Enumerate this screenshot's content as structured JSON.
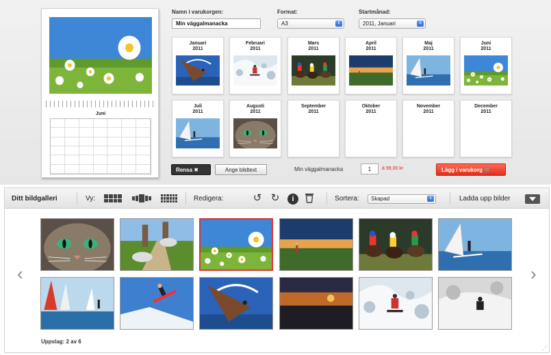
{
  "editor": {
    "name_label": "Namn i varukorgen:",
    "name_value": "Min väggalmanacka",
    "format_label": "Format:",
    "format_value": "A3",
    "start_label": "Startmånad:",
    "start_value": "2011, Januari",
    "months": [
      {
        "name": "Januari",
        "year": "2011",
        "photo": "kite-surfer-photo"
      },
      {
        "name": "Februari",
        "year": "2011",
        "photo": "snowboarder-snow-photo"
      },
      {
        "name": "Mars",
        "year": "2011",
        "photo": "horse-race-photo"
      },
      {
        "name": "April",
        "year": "2011",
        "photo": "golfer-sunset-photo"
      },
      {
        "name": "Maj",
        "year": "2011",
        "photo": "windsurfer-photo"
      },
      {
        "name": "Juni",
        "year": "2011",
        "photo": "daisy-meadow-photo"
      },
      {
        "name": "Juli",
        "year": "2011",
        "photo": "windsurfer-photo"
      },
      {
        "name": "Augusti",
        "year": "2011",
        "photo": "cat-face-photo"
      },
      {
        "name": "September",
        "year": "2011",
        "photo": ""
      },
      {
        "name": "Oktober",
        "year": "2011",
        "photo": ""
      },
      {
        "name": "November",
        "year": "2011",
        "photo": ""
      },
      {
        "name": "December",
        "year": "2011",
        "photo": ""
      }
    ],
    "clear_label": "Rensa ✖",
    "caption_label": "Ange bildtext",
    "qty_label": "Min väggalmanacka",
    "qty_value": "1",
    "price": "à 99,00 kr",
    "cart_label": "Lägg i varukorg 🛒"
  },
  "preview": {
    "month": "Juni",
    "photo": "daisy-meadow-photo"
  },
  "gallery": {
    "title": "Ditt bildgalleri",
    "view_label": "Vy:",
    "edit_label": "Redigera:",
    "sort_label": "Sortera:",
    "sort_value": "Skapad",
    "upload_label": "Ladda upp bilder",
    "page_info": "Uppslag: 2 av 6",
    "thumbs": [
      "cat-face-photo",
      "runner-feet-photo",
      "daisy-meadow-photo",
      "golfer-sunset-photo",
      "horse-race-photo",
      "windsurfer-photo",
      "sailboats-photo",
      "snowboarder-sky-photo",
      "kite-surfer-photo",
      "sunset-sky-photo",
      "snowboarder-snow-photo",
      "skier-snow-photo"
    ],
    "selected_index": 2
  },
  "colors": {
    "accent": "#e22d1c",
    "selected_border": "#dd3333",
    "toolbar_bg": "#e6e6e6"
  }
}
